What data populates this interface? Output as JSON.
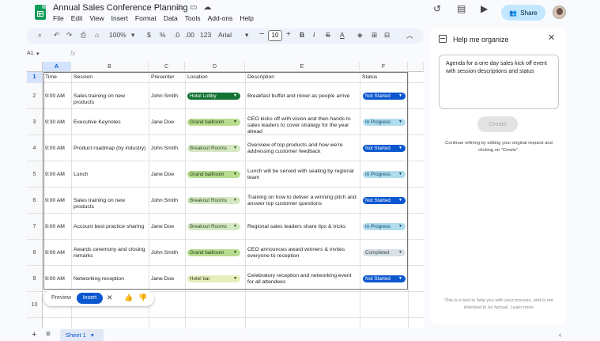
{
  "app": {
    "doc_title": "Annual Sales Conference Planning",
    "menu": [
      "File",
      "Edit",
      "View",
      "Insert",
      "Format",
      "Data",
      "Tools",
      "Add-ons",
      "Help"
    ],
    "share_label": "Share"
  },
  "toolbar": {
    "zoom": "100%",
    "percent": "%",
    "decimal": ".0",
    "decimal2": ".00",
    "number_format": "123",
    "font": "Arial",
    "font_size": "10"
  },
  "formula_bar": {
    "cell_ref": "A1",
    "fx": "fx"
  },
  "columns": [
    "A",
    "B",
    "C",
    "D",
    "E",
    "F"
  ],
  "table": {
    "headers": [
      "Time",
      "Session",
      "Presenter",
      "Location",
      "Description",
      "Status"
    ],
    "rows": [
      {
        "time": "9:00 AM",
        "session": "Sales training on new products",
        "presenter": "John Smith",
        "location": "Hotel Lobby",
        "location_style": "dark",
        "description": "Breakfast buffet and mixer as people arrive",
        "status": "Not Started",
        "status_style": "notstarted"
      },
      {
        "time": "9:30 AM",
        "session": "Executive Keynotes",
        "presenter": "Jane Doe",
        "location": "Grand ballroom",
        "location_style": "green",
        "description": "CEO kicks off with vision and then hands to sales leaders to cover strategy for the year ahead",
        "status": "In Progress",
        "status_style": "inprogress"
      },
      {
        "time": "9:00 AM",
        "session": "Product roadmap (by industry)",
        "presenter": "John Smith",
        "location": "Breakout Rooms",
        "location_style": "lightgreen",
        "description": "Overview of top products and how we're addressing customer feedback",
        "status": "Not Started",
        "status_style": "notstarted"
      },
      {
        "time": "9:00 AM",
        "session": "Lunch",
        "presenter": "Jane Doe",
        "location": "Grand ballroom",
        "location_style": "green",
        "description": "Lunch will be served with seating by regional team",
        "status": "In Progress",
        "status_style": "inprogress"
      },
      {
        "time": "9:00 AM",
        "session": "Sales training on new products",
        "presenter": "John Smith",
        "location": "Breakout Rooms",
        "location_style": "lightgreen",
        "description": "Training on how to deliver a winning pitch and answer top customer questions",
        "status": "Not Started",
        "status_style": "notstarted"
      },
      {
        "time": "9:00 AM",
        "session": "Account best practice sharing",
        "presenter": "Jane Doe",
        "location": "Breakout Rooms",
        "location_style": "lightgreen",
        "description": "Regional sales leaders share tips & tricks",
        "status": "In Progress",
        "status_style": "inprogress"
      },
      {
        "time": "9:00 AM",
        "session": "Awards ceremony and closing remarks",
        "presenter": "John Smith",
        "location": "Grand ballroom",
        "location_style": "green",
        "description": "CEO announces award winners & invites everyone to reception",
        "status": "Completed",
        "status_style": "completed"
      },
      {
        "time": "9:00 AM",
        "session": "Networking reception",
        "presenter": "Jane Doe",
        "location": "Hotel bar",
        "location_style": "yellow",
        "description": "Celebratory reception and networking event for all attendees",
        "status": "Not Started",
        "status_style": "notstarted"
      }
    ]
  },
  "row_numbers": [
    "1",
    "2",
    "3",
    "4",
    "5",
    "6",
    "7",
    "8",
    "9",
    "10",
    "11"
  ],
  "preview_bar": {
    "preview_label": "Preview",
    "insert_label": "Insert"
  },
  "sheet_tab": "Sheet 1",
  "side_panel": {
    "title": "Help me organize",
    "prompt": "Agenda for a one day sales kick off event with session descriptions and status",
    "create_label": "Create",
    "hint": "Continue refining by editing your original request and clicking on \"Create\".",
    "footer": "This is a tool to help you with your process, and is not intended to be factual. Learn more"
  },
  "colors": {
    "accent": "#0b57d0",
    "chip_dark_green": "#137333",
    "chip_green": "#b7dc8e",
    "chip_lightgreen": "#d4e8c2",
    "chip_yellow": "#e6efbb",
    "status_notstarted": "#0b57d0",
    "status_inprogress": "#b1dcee",
    "status_completed": "#d6e0e6"
  }
}
